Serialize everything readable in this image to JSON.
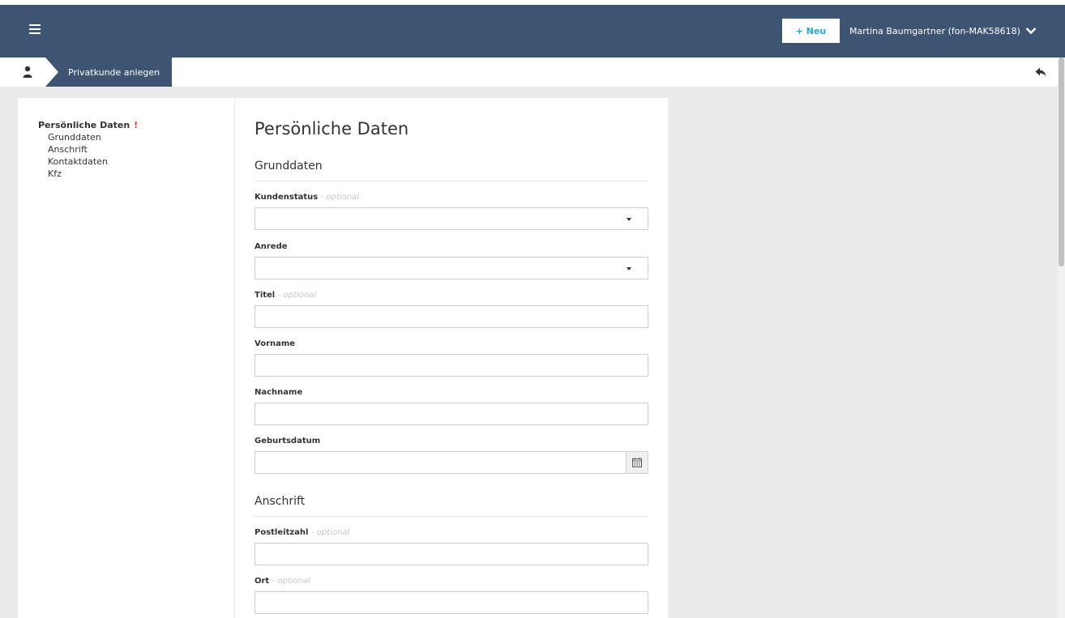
{
  "header": {
    "menu_icon": "hamburger-icon",
    "new_button_label": "+ Neu",
    "user_label": "Martina Baumgartner (fon-MAK58618)",
    "user_chevron_icon": "chevron-down-icon",
    "bg_color": "#3e5473",
    "accent_color": "#2aa5d8"
  },
  "breadcrumb": {
    "person_icon": "person-icon",
    "current": "Privatkunde anlegen",
    "back_icon": "reply-arrow-icon"
  },
  "sidenav": {
    "section_title": "Persönliche Daten",
    "required_marker": "!",
    "items": [
      "Grunddaten",
      "Anschrift",
      "Kontaktdaten",
      "Kfz"
    ]
  },
  "form": {
    "title": "Persönliche Daten",
    "sections": {
      "grunddaten": "Grunddaten",
      "anschrift": "Anschrift"
    },
    "optional_suffix": "- optional",
    "fields": {
      "kundenstatus": {
        "label": "Kundenstatus",
        "value": ""
      },
      "anrede": {
        "label": "Anrede",
        "value": ""
      },
      "titel": {
        "label": "Titel",
        "value": ""
      },
      "vorname": {
        "label": "Vorname",
        "value": ""
      },
      "nachname": {
        "label": "Nachname",
        "value": ""
      },
      "geburtsdatum": {
        "label": "Geburtsdatum",
        "value": "",
        "icon": "calendar-icon"
      },
      "postleitzahl": {
        "label": "Postleitzahl",
        "value": ""
      },
      "ort": {
        "label": "Ort",
        "value": ""
      }
    }
  }
}
